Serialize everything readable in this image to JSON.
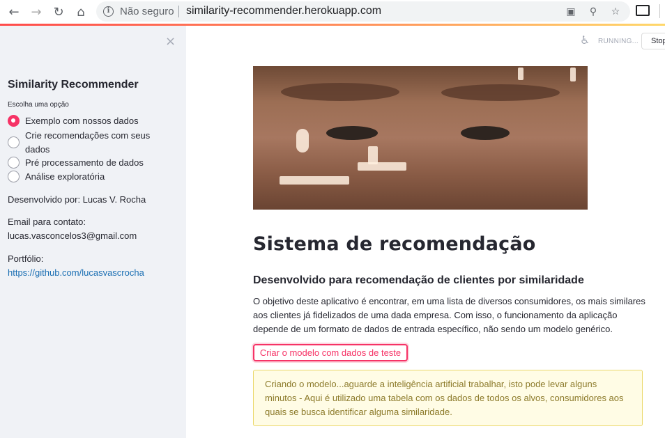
{
  "browser": {
    "security_label": "Não seguro",
    "url": "similarity-recommender.herokuapp.com"
  },
  "sidebar": {
    "close_symbol": "×",
    "title": "Similarity Recommender",
    "radio_label": "Escolha uma opção",
    "options": [
      "Exemplo com nossos dados",
      "Crie recomendações com seus dados",
      "Pré processamento de dados",
      "Análise exploratória"
    ],
    "selected_index": 0,
    "developer": "Desenvolvido por: Lucas V. Rocha",
    "email_label": "Email para contato:",
    "email": "lucas.vasconcelos3@gmail.com",
    "portfolio_label": "Portfólio:",
    "portfolio_link": "https://github.com/lucasvascrocha"
  },
  "status": {
    "running_text": "RUNNING...",
    "stop_label": "Stop"
  },
  "main": {
    "title": "Sistema de recomendação",
    "subtitle": "Desenvolvido para recomendação de clientes por similaridade",
    "description": "O objetivo deste aplicativo é encontrar, em uma lista de diversos consumidores, os mais similares aos clientes já fidelizados de uma dada empresa. Com isso, o funcionamento da aplicação depende de um formato de dados de entrada específico, não sendo um modelo genérico.",
    "button_label": "Criar o modelo com dados de teste",
    "warning": "Criando o modelo...aguarde a inteligência artificial trabalhar, isto pode levar alguns minutos - Aqui é utilizado uma tabela com os dados de todos os alvos, consumidores aos quais se busca identificar alguma similaridade."
  },
  "colors": {
    "accent": "#f63366",
    "sidebar_bg": "#f0f2f6",
    "link": "#1b6fb3",
    "warning_bg": "#fffce5",
    "warning_text": "#8c7a2a"
  }
}
